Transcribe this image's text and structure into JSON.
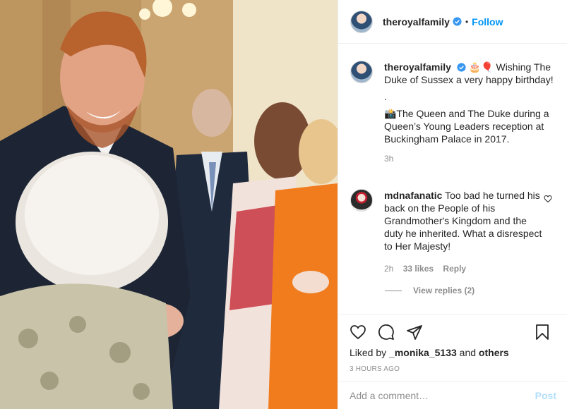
{
  "post": {
    "username": "theroyalfamily",
    "follow_label": "Follow",
    "separator": "•",
    "caption": {
      "emoji_prefix": "🎂🎈",
      "line1": "Wishing The Duke of Sussex a very happy birthday!",
      "line2": ".",
      "line3": "📸The Queen and The Duke during a Queen’s Young Leaders reception at Buckingham Palace in 2017.",
      "time": "3h"
    },
    "comment": {
      "username": "mdnafanatic",
      "text": "Too bad he turned his back on the People of his Grandmother's Kingdom and the duty he inherited. What a disrespect to Her Majesty!",
      "time": "2h",
      "likes": "33 likes",
      "reply_label": "Reply"
    },
    "view_replies": "View replies (2)",
    "liked_by": {
      "prefix": "Liked by",
      "user": "_monika_5133",
      "and": "and",
      "others": "others"
    },
    "posted_ago": "3 HOURS AGO",
    "add_comment_placeholder": "Add a comment…",
    "post_label": "Post"
  },
  "icons": {
    "verified": "verified-badge-icon",
    "like": "heart-icon",
    "comment": "comment-icon",
    "share": "share-icon",
    "save": "bookmark-icon",
    "comment_like": "heart-icon"
  },
  "colors": {
    "accent": "#0095f6",
    "muted": "#8e8e8e",
    "post_disabled": "#b2dffc"
  }
}
